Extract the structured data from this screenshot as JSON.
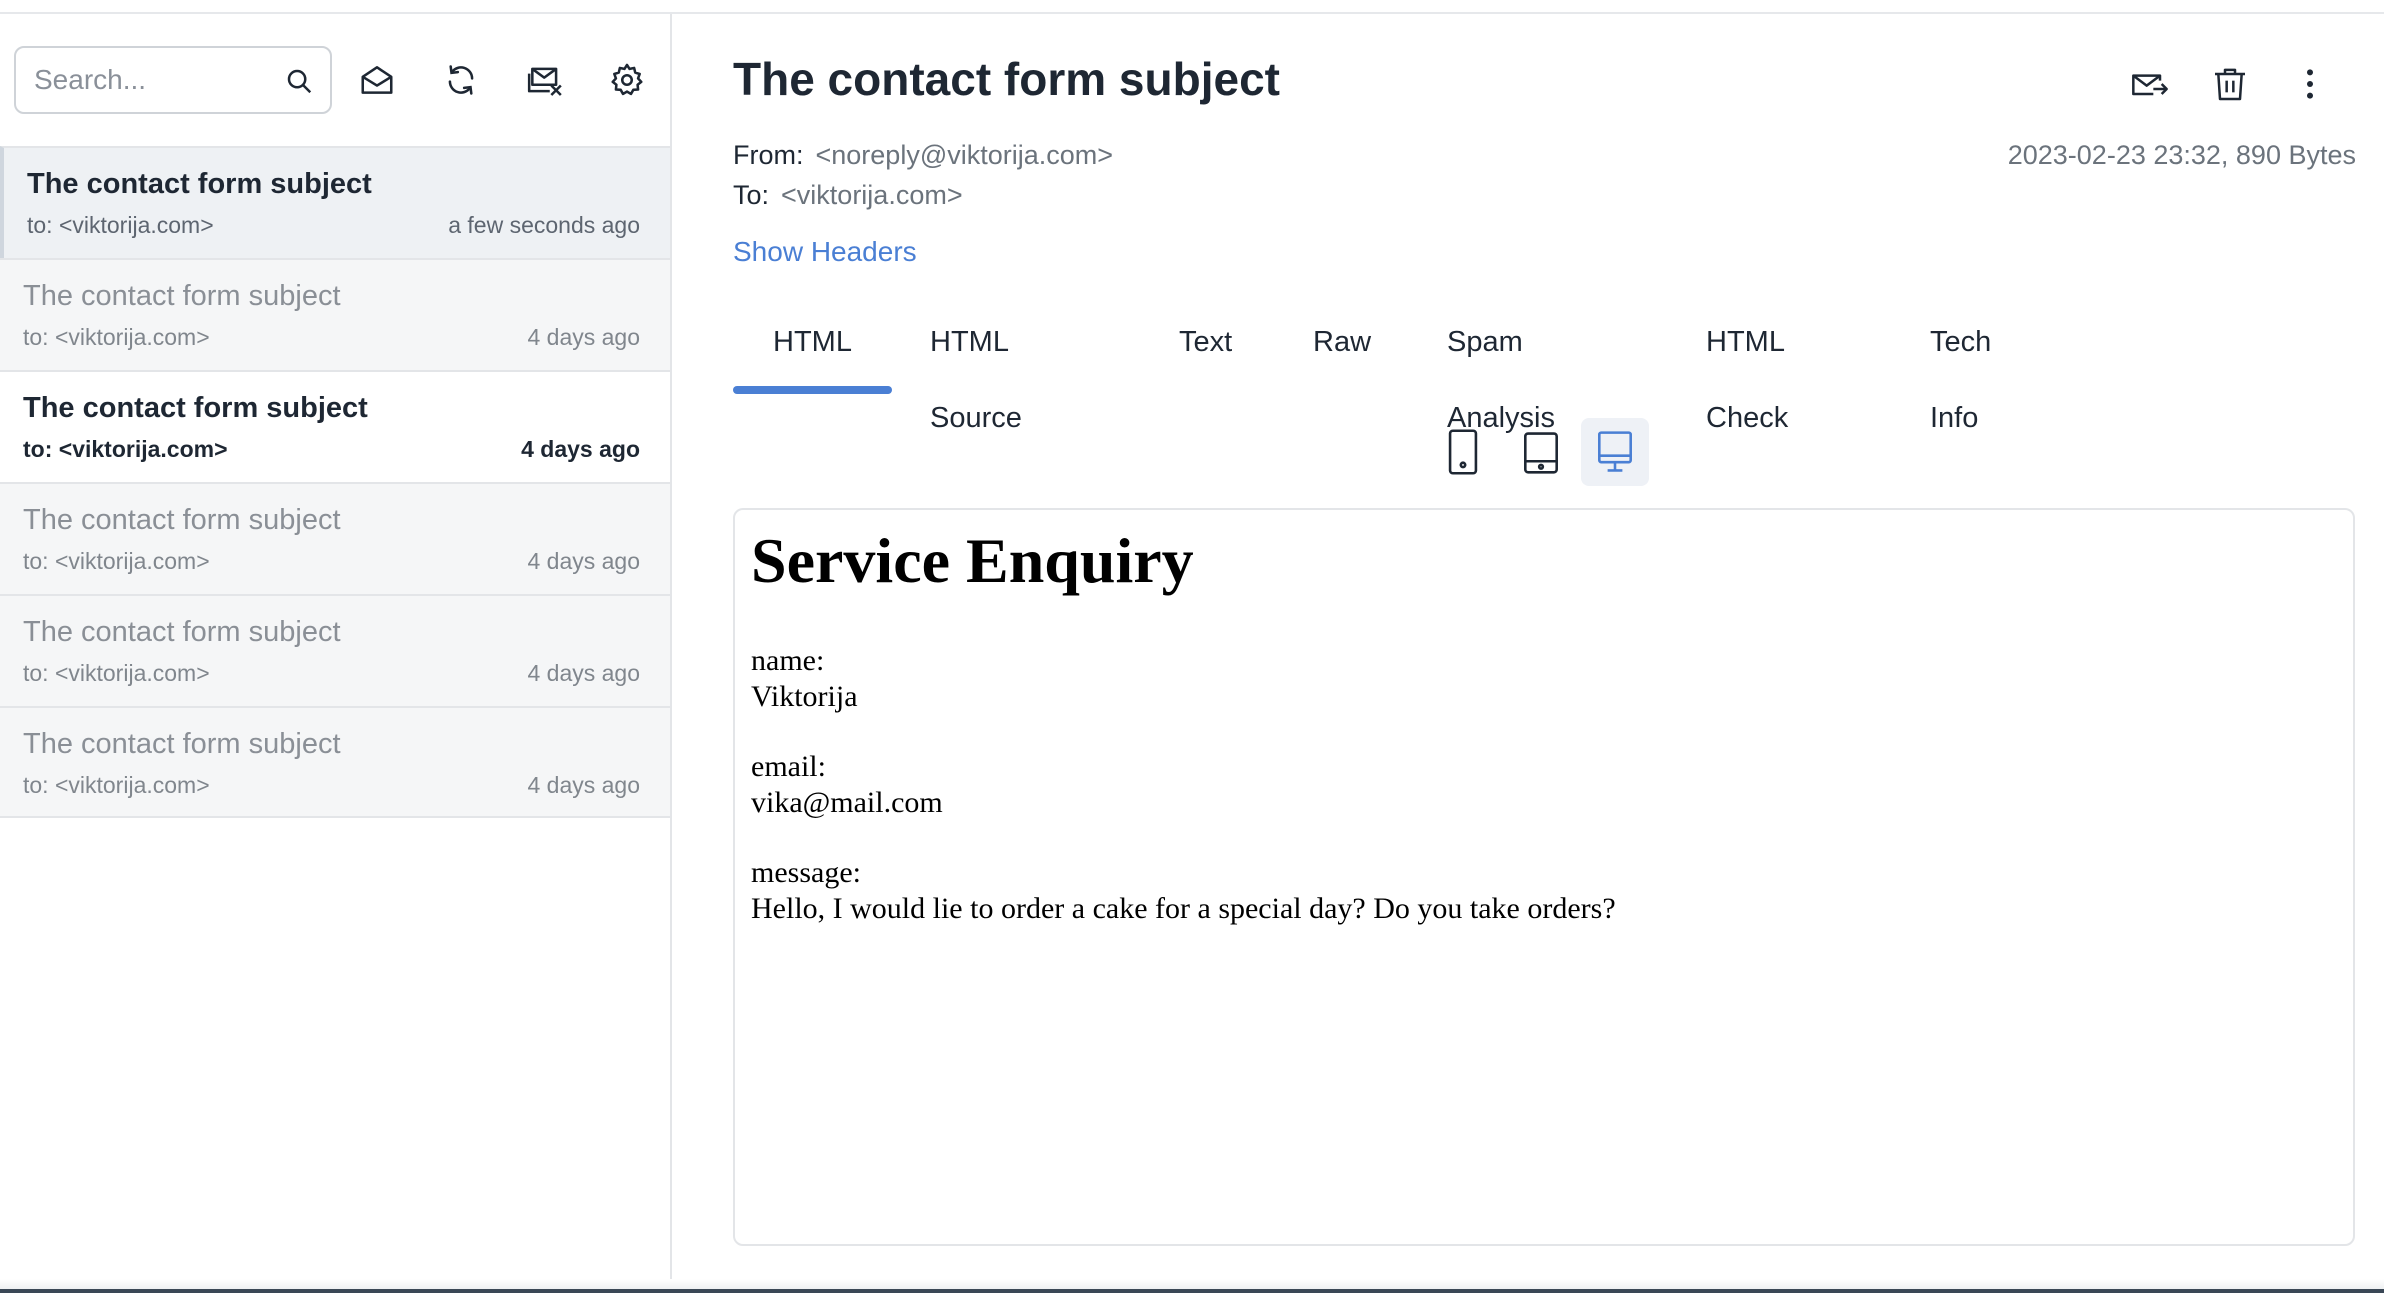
{
  "sidebar": {
    "search_placeholder": "Search...",
    "icons": [
      "search-icon",
      "mark-read-icon",
      "refresh-icon",
      "delete-all-icon",
      "settings-icon"
    ],
    "messages": [
      {
        "subject": "The contact form subject",
        "to": "to: <viktorija.com>",
        "when": "a few seconds ago",
        "state": "active"
      },
      {
        "subject": "The contact form subject",
        "to": "to: <viktorija.com>",
        "when": "4 days ago",
        "state": "read"
      },
      {
        "subject": "The contact form subject",
        "to": "to: <viktorija.com>",
        "when": "4 days ago",
        "state": "unread"
      },
      {
        "subject": "The contact form subject",
        "to": "to: <viktorija.com>",
        "when": "4 days ago",
        "state": "read"
      },
      {
        "subject": "The contact form subject",
        "to": "to: <viktorija.com>",
        "when": "4 days ago",
        "state": "read"
      },
      {
        "subject": "The contact form subject",
        "to": "to: <viktorija.com>",
        "when": "4 days ago",
        "state": "read"
      }
    ]
  },
  "message": {
    "title": "The contact form subject",
    "from_label": "From:",
    "from_value": "<noreply@viktorija.com>",
    "to_label": "To:",
    "to_value": "<viktorija.com>",
    "date_size": "2023-02-23 23:32, 890 Bytes",
    "show_headers": "Show Headers",
    "actions": [
      "release-icon",
      "trash-icon",
      "more-vertical-icon"
    ]
  },
  "tabs": [
    {
      "label": "HTML",
      "active": true
    },
    {
      "label": "HTML Source",
      "active": false
    },
    {
      "label": "Text",
      "active": false
    },
    {
      "label": "Raw",
      "active": false
    },
    {
      "label": "Spam Analysis",
      "active": false
    },
    {
      "label": "HTML Check",
      "active": false
    },
    {
      "label": "Tech Info",
      "active": false
    }
  ],
  "devices": {
    "items": [
      "phone-icon",
      "tablet-icon",
      "desktop-icon"
    ],
    "selected": "desktop-icon"
  },
  "preview": {
    "heading": "Service Enquiry",
    "name_label": "name:",
    "name_value": "Viktorija",
    "email_label": "email:",
    "email_value": "vika@mail.com",
    "message_label": "message:",
    "message_value": "Hello, I would lie to order a cake for a special day? Do you take orders?"
  },
  "colors": {
    "accent": "#4a7fd4",
    "text": "#1e2733",
    "muted": "#80868d",
    "border": "#e3e5e8"
  }
}
